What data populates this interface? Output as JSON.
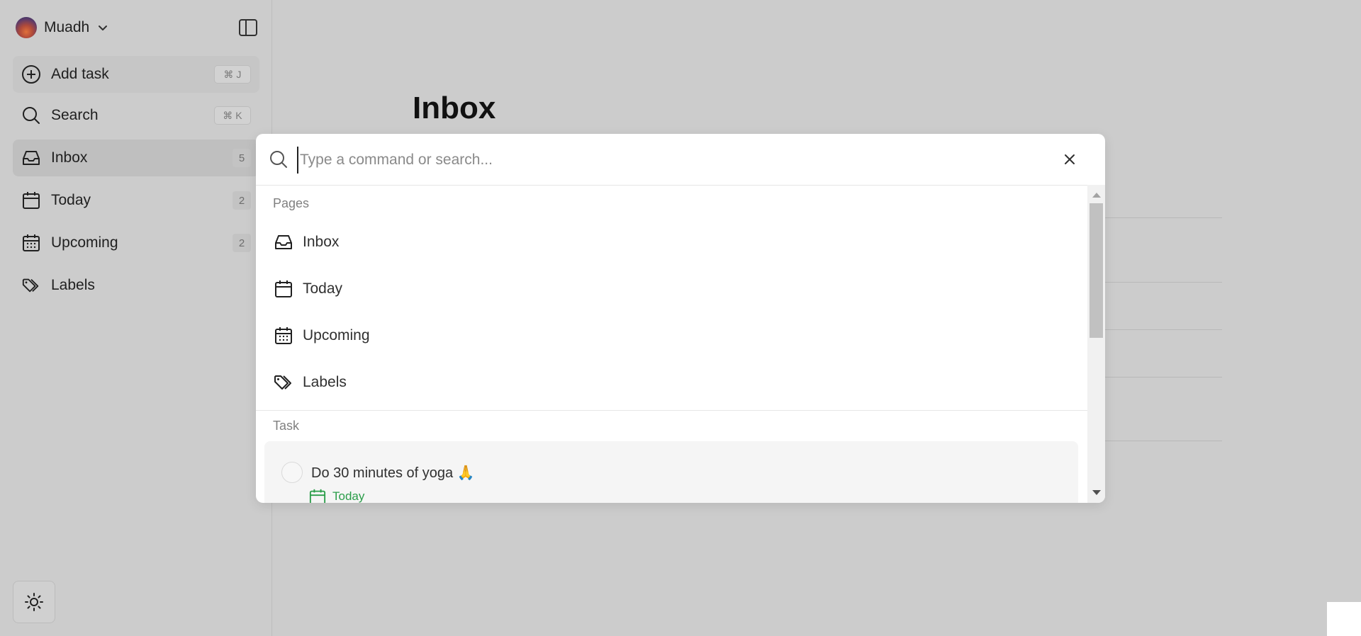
{
  "user": {
    "name": "Muadh"
  },
  "sidebar": {
    "items": [
      {
        "label": "Add task",
        "shortcut": "⌘ J"
      },
      {
        "label": "Search",
        "shortcut": "⌘ K"
      },
      {
        "label": "Inbox",
        "count": "5"
      },
      {
        "label": "Today",
        "count": "2"
      },
      {
        "label": "Upcoming",
        "count": "2"
      },
      {
        "label": "Labels"
      }
    ]
  },
  "main": {
    "title": "Inbox"
  },
  "palette": {
    "placeholder": "Type a command or search...",
    "sections": {
      "pages": "Pages",
      "task": "Task"
    },
    "pages": [
      {
        "label": "Inbox",
        "icon": "inbox-icon"
      },
      {
        "label": "Today",
        "icon": "calendar-icon"
      },
      {
        "label": "Upcoming",
        "icon": "calendar-grid-icon"
      },
      {
        "label": "Labels",
        "icon": "tags-icon"
      }
    ],
    "tasks": [
      {
        "title": "Do 30 minutes of yoga 🙏",
        "due": "Today"
      }
    ]
  },
  "colors": {
    "accent_green": "#2a9d49",
    "overlay": "#cccccc"
  }
}
